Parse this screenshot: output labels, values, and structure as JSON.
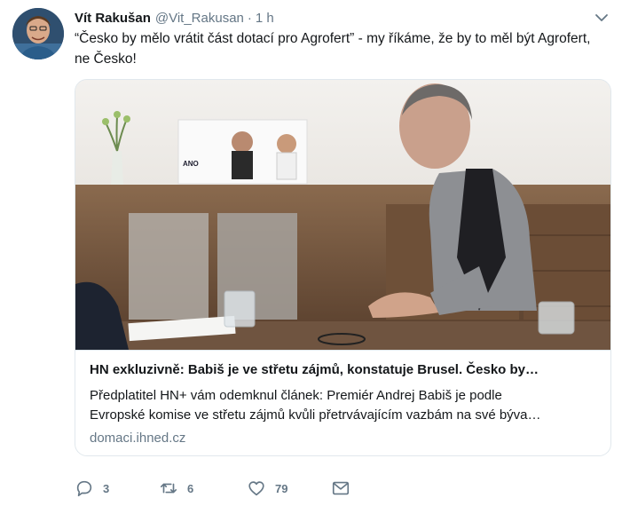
{
  "tweet": {
    "author_name": "Vít Rakušan",
    "author_handle": "@Vit_Rakusan",
    "separator": "·",
    "time": "1 h",
    "text": "“Česko by mělo vrátit část dotací pro Agrofert” - my říkáme, že by to měl být Agrofert, ne Česko!"
  },
  "card": {
    "title": "HN exkluzivně: Babiš je ve střetu zájmů, konstatuje Brusel. Česko by…",
    "description_line1": "Předplatitel HN+ vám odemknul článek: Premiér Andrej Babiš je podle",
    "description_line2": "Evropské komise ve střetu zájmů kvůli přetrvávajícím vazbám na své býva…",
    "domain": "domaci.ihned.cz",
    "image_poster_text": "ANO"
  },
  "actions": {
    "replies": "3",
    "retweets": "6",
    "likes": "79"
  },
  "icons": {
    "caret": "chevron-down-icon",
    "reply": "reply-icon",
    "retweet": "retweet-icon",
    "like": "heart-icon",
    "dm": "envelope-icon"
  },
  "colors": {
    "text": "#14171a",
    "secondary": "#657786",
    "border": "#e1e8ed"
  }
}
